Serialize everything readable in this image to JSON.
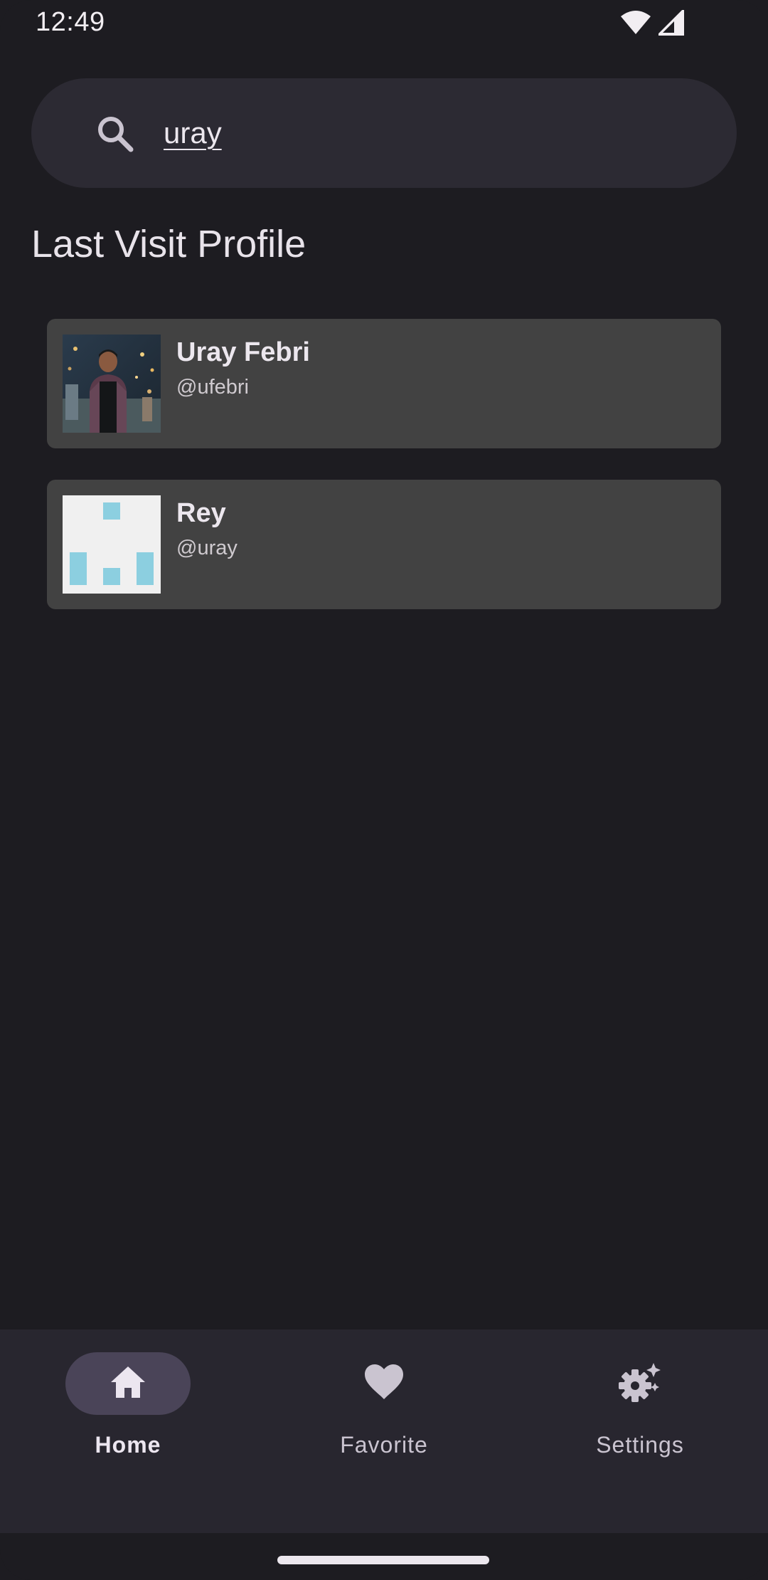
{
  "status_bar": {
    "time": "12:49",
    "icons": [
      "wifi-icon",
      "cellular-signal-icon"
    ]
  },
  "search": {
    "value": "uray",
    "icon": "search-icon"
  },
  "section": {
    "title": "Last Visit Profile"
  },
  "profiles": [
    {
      "name": "Uray Febri",
      "handle": "@ufebri",
      "avatar": "photo-avatar"
    },
    {
      "name": "Rey",
      "handle": "@uray",
      "avatar": "identicon-avatar"
    }
  ],
  "bottom_nav": {
    "items": [
      {
        "label": "Home",
        "icon": "home-icon",
        "active": true
      },
      {
        "label": "Favorite",
        "icon": "heart-icon",
        "active": false
      },
      {
        "label": "Settings",
        "icon": "settings-sparkle-icon",
        "active": false
      }
    ]
  },
  "colors": {
    "background": "#1d1c21",
    "search_bg": "#2c2a33",
    "card_bg": "#424242",
    "nav_bg": "#28262f",
    "nav_active_pill": "#4a4458",
    "identicon": "#8ccfe0"
  }
}
